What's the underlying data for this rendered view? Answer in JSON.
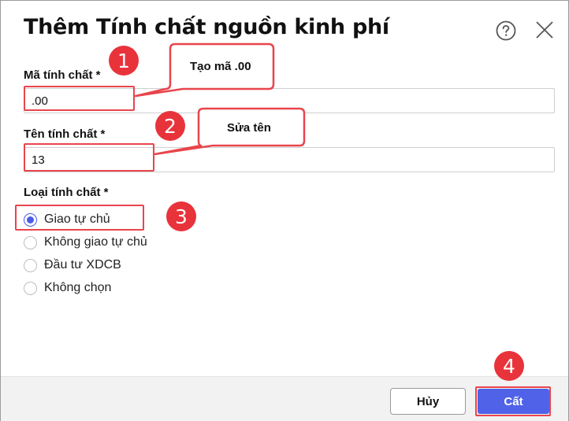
{
  "dialog": {
    "title": "Thêm Tính chất nguồn kinh phí",
    "help_icon": "help-circle-icon",
    "close_icon": "close-icon"
  },
  "form": {
    "code": {
      "label": "Mã tính chất *",
      "value": ".00"
    },
    "name": {
      "label": "Tên tính chất *",
      "value": "13"
    },
    "type": {
      "label": "Loại tính chất *",
      "options": [
        {
          "label": "Giao tự chủ",
          "checked": true
        },
        {
          "label": "Không giao tự chủ",
          "checked": false
        },
        {
          "label": "Đầu tư XDCB",
          "checked": false
        },
        {
          "label": "Không chọn",
          "checked": false
        }
      ]
    }
  },
  "footer": {
    "cancel_label": "Hủy",
    "save_label": "Cất"
  },
  "annotations": {
    "accent_color": "#e8333b",
    "steps": [
      {
        "number": "1",
        "note": "Tạo mã .00"
      },
      {
        "number": "2",
        "note": "Sửa tên"
      },
      {
        "number": "3",
        "note": ""
      },
      {
        "number": "4",
        "note": ""
      }
    ]
  },
  "colors": {
    "primary": "#4f62e8",
    "footer_bg": "#f2f2f2"
  }
}
